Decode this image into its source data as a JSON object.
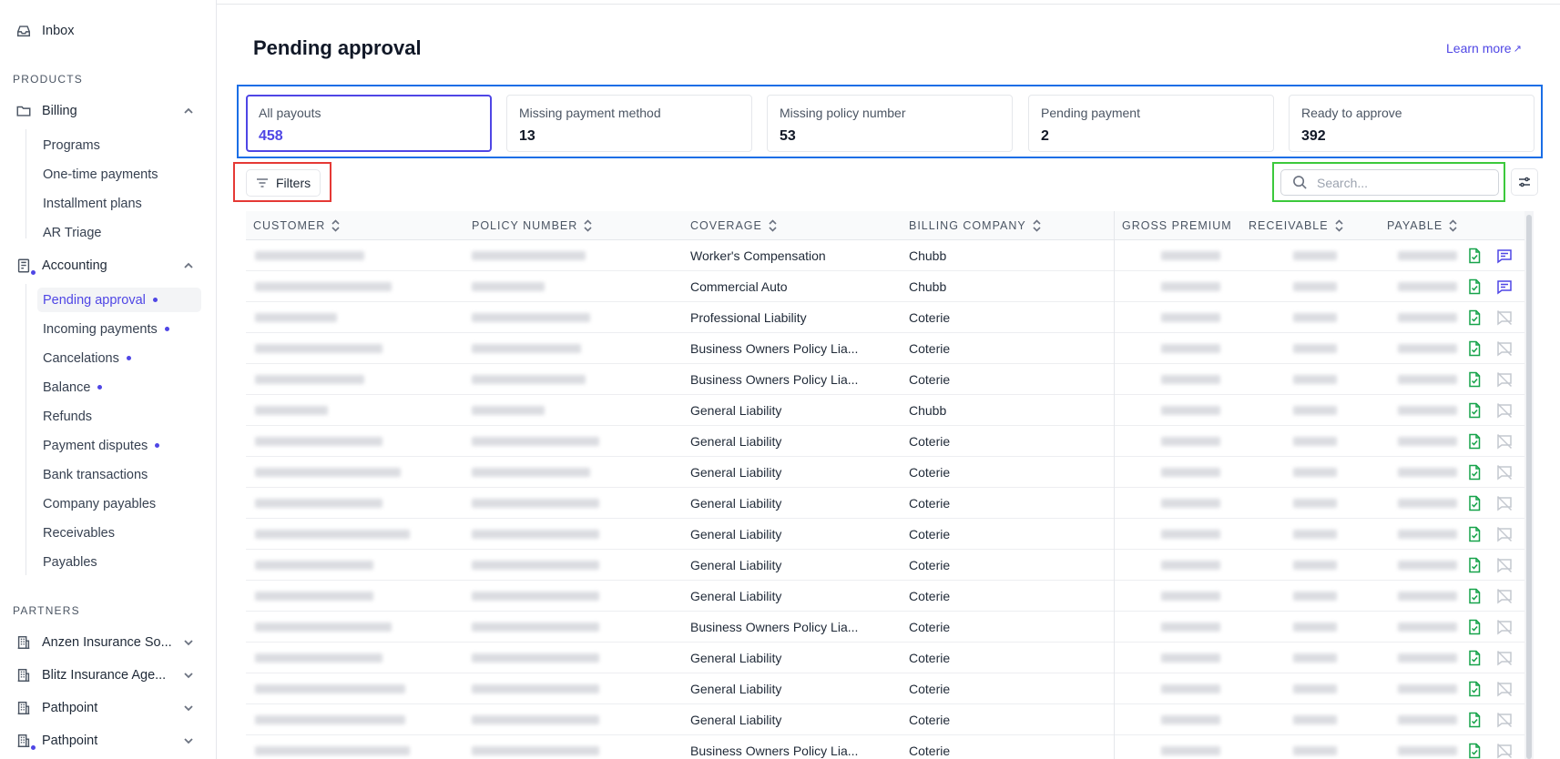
{
  "sidebar": {
    "inbox": "Inbox",
    "products_header": "PRODUCTS",
    "billing": {
      "label": "Billing",
      "items": [
        "Programs",
        "One-time payments",
        "Installment plans",
        "AR Triage"
      ]
    },
    "accounting": {
      "label": "Accounting",
      "items": [
        {
          "label": "Pending approval",
          "dot": true,
          "active": true
        },
        {
          "label": "Incoming payments",
          "dot": true
        },
        {
          "label": "Cancelations",
          "dot": true
        },
        {
          "label": "Balance",
          "dot": true
        },
        {
          "label": "Refunds",
          "dot": false
        },
        {
          "label": "Payment disputes",
          "dot": true
        },
        {
          "label": "Bank transactions",
          "dot": false
        },
        {
          "label": "Company payables",
          "dot": false
        },
        {
          "label": "Receivables",
          "dot": false
        },
        {
          "label": "Payables",
          "dot": false
        }
      ]
    },
    "partners_header": "PARTNERS",
    "partners": [
      "Anzen Insurance So...",
      "Blitz Insurance Age...",
      "Pathpoint",
      "Pathpoint"
    ]
  },
  "page": {
    "title": "Pending approval",
    "learn_more": "Learn more",
    "learn_more_arrow": "↗"
  },
  "stats": [
    {
      "label": "All payouts",
      "value": "458",
      "active": true
    },
    {
      "label": "Missing payment method",
      "value": "13"
    },
    {
      "label": "Missing policy number",
      "value": "53"
    },
    {
      "label": "Pending payment",
      "value": "2"
    },
    {
      "label": "Ready to approve",
      "value": "392"
    }
  ],
  "toolbar": {
    "filters_label": "Filters",
    "search_placeholder": "Search..."
  },
  "table": {
    "columns": [
      "CUSTOMER",
      "POLICY NUMBER",
      "COVERAGE",
      "BILLING COMPANY",
      "GROSS PREMIUM",
      "RECEIVABLE",
      "PAYABLE"
    ],
    "rows": [
      {
        "coverage": "Worker's Compensation",
        "billing": "Chubb",
        "comment": true
      },
      {
        "coverage": "Commercial Auto",
        "billing": "Chubb",
        "comment": true
      },
      {
        "coverage": "Professional Liability",
        "billing": "Coterie",
        "comment": false
      },
      {
        "coverage": "Business Owners Policy Lia...",
        "billing": "Coterie",
        "comment": false
      },
      {
        "coverage": "Business Owners Policy Lia...",
        "billing": "Coterie",
        "comment": false
      },
      {
        "coverage": "General Liability",
        "billing": "Chubb",
        "comment": false
      },
      {
        "coverage": "General Liability",
        "billing": "Coterie",
        "comment": false
      },
      {
        "coverage": "General Liability",
        "billing": "Coterie",
        "comment": false
      },
      {
        "coverage": "General Liability",
        "billing": "Coterie",
        "comment": false
      },
      {
        "coverage": "General Liability",
        "billing": "Coterie",
        "comment": false
      },
      {
        "coverage": "General Liability",
        "billing": "Coterie",
        "comment": false
      },
      {
        "coverage": "General Liability",
        "billing": "Coterie",
        "comment": false
      },
      {
        "coverage": "Business Owners Policy Lia...",
        "billing": "Coterie",
        "comment": false
      },
      {
        "coverage": "General Liability",
        "billing": "Coterie",
        "comment": false
      },
      {
        "coverage": "General Liability",
        "billing": "Coterie",
        "comment": false
      },
      {
        "coverage": "General Liability",
        "billing": "Coterie",
        "comment": false
      },
      {
        "coverage": "Business Owners Policy Lia...",
        "billing": "Coterie",
        "comment": false
      }
    ]
  },
  "icons": {
    "inbox": "inbox-icon",
    "billing": "folder-icon",
    "accounting": "ledger-icon",
    "partner": "building-icon",
    "filters": "filter-lines-icon",
    "search": "search-icon",
    "settings": "sliders-icon",
    "approve": "document-check-icon",
    "comment": "comment-icon",
    "comment_off": "comment-off-icon"
  },
  "colors": {
    "accent": "#4f46e5",
    "approve": "#16a34a",
    "comment_off": "#c4c8cf"
  }
}
